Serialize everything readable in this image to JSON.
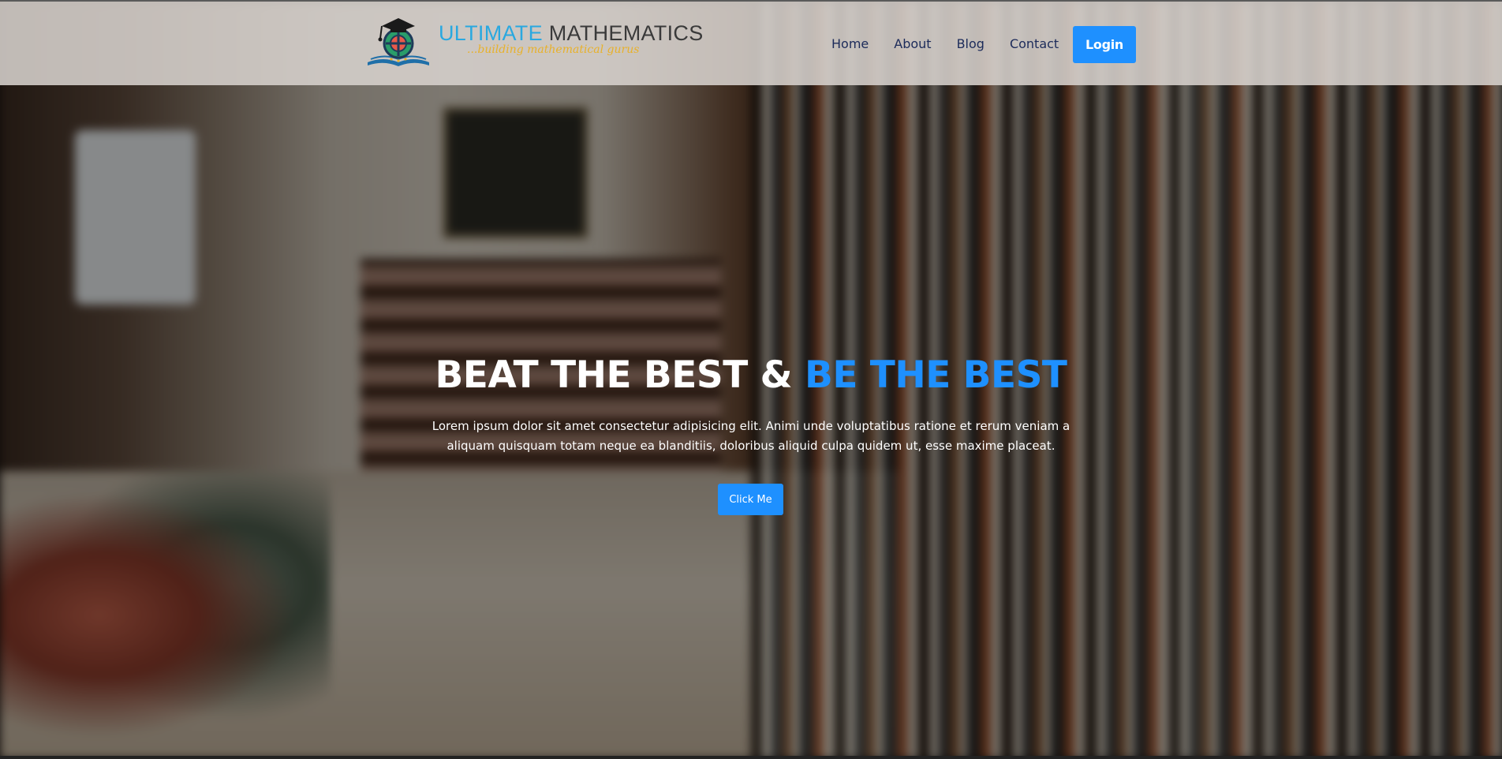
{
  "header": {
    "logo": {
      "title_part1": "ULTIMATE",
      "title_part2": "MATHEMATICS",
      "tagline": "...building mathematical gurus",
      "icon": "graduation-cap-book-logo"
    },
    "nav": [
      {
        "label": "Home"
      },
      {
        "label": "About"
      },
      {
        "label": "Blog"
      },
      {
        "label": "Contact"
      }
    ],
    "login_label": "Login"
  },
  "hero": {
    "title_part1": "BEAT THE BEST &",
    "title_part2": "BE THE BEST",
    "text_line1": "Lorem ipsum dolor sit amet consectetur adipisicing elit. Animi unde voluptatibus ratione et rerum veniam a",
    "text_line2": "aliquam quisquam totam neque ea blanditiis, doloribus aliquid culpa quidem ut, esse maxime placeat.",
    "button_label": "Click Me"
  },
  "colors": {
    "accent": "#1e90ff",
    "logo_blue": "#29a8e0",
    "logo_gold": "#e8b12a",
    "nav_text": "#1c2b5a"
  }
}
